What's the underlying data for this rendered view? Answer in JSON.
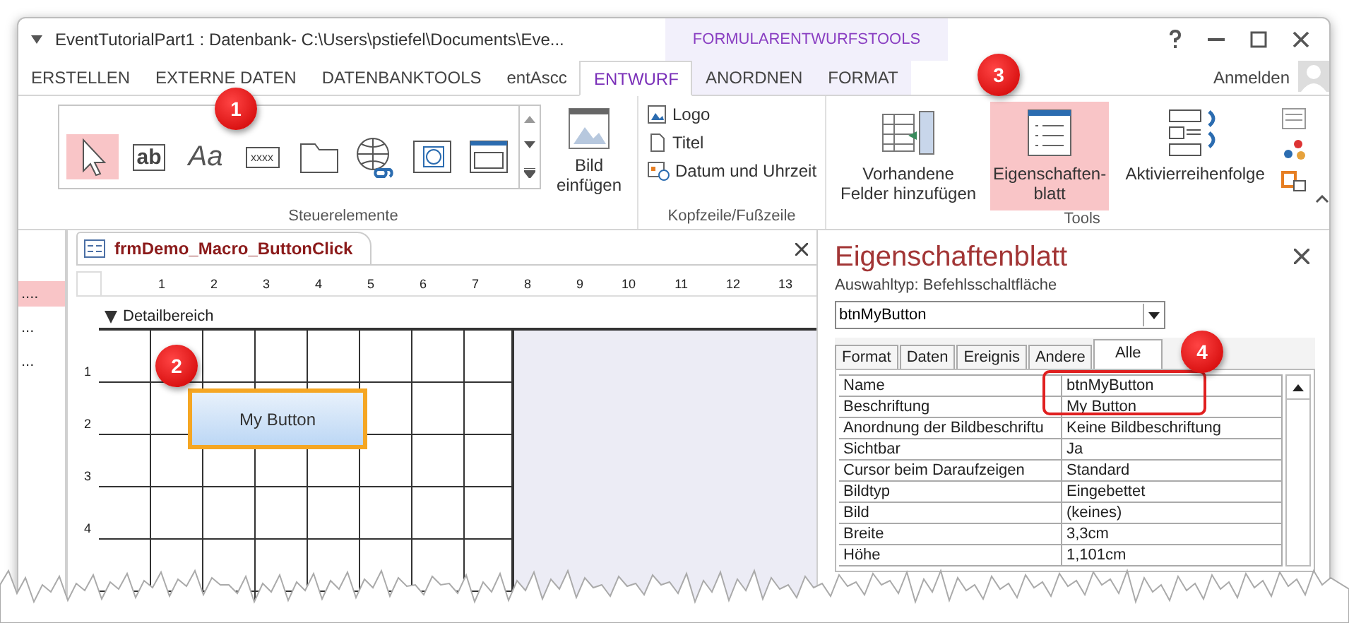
{
  "window": {
    "title": "EventTutorialPart1 : Datenbank- C:\\Users\\pstiefel\\Documents\\Eve...",
    "context_group": "FORMULARENTWURFSTOOLS",
    "user": "Anmelden"
  },
  "ribbon_tabs": [
    {
      "label": "ERSTELLEN",
      "selected": false,
      "contextual": false
    },
    {
      "label": "EXTERNE DATEN",
      "selected": false,
      "contextual": false
    },
    {
      "label": "DATENBANKTOOLS",
      "selected": false,
      "contextual": false
    },
    {
      "label": "entAscc",
      "selected": false,
      "contextual": false
    },
    {
      "label": "ENTWURF",
      "selected": true,
      "contextual": true
    },
    {
      "label": "ANORDNEN",
      "selected": false,
      "contextual": true
    },
    {
      "label": "FORMAT",
      "selected": false,
      "contextual": true
    }
  ],
  "controls_gallery": {
    "group": "Steuerelemente",
    "items": [
      {
        "kind": "pointer",
        "selected": true
      },
      {
        "kind": "textbox",
        "label": "ab",
        "selected": false
      },
      {
        "kind": "label",
        "label": "Aa",
        "selected": false
      },
      {
        "kind": "button",
        "label": "xxxx",
        "selected": false
      },
      {
        "kind": "tab",
        "selected": false
      },
      {
        "kind": "hyperlink",
        "selected": false
      },
      {
        "kind": "web",
        "selected": false
      },
      {
        "kind": "navigation",
        "selected": false
      }
    ]
  },
  "insert_image": {
    "label": "Bild einfügen"
  },
  "header_footer": {
    "group": "Kopfzeile/Fußzeile",
    "items": [
      {
        "kind": "logo",
        "label": "Logo"
      },
      {
        "kind": "title",
        "label": "Titel"
      },
      {
        "kind": "datetime",
        "label": "Datum und Uhrzeit"
      }
    ]
  },
  "tools": {
    "group": "Tools",
    "items": [
      {
        "kind": "fields",
        "label": "Vorhandene Felder hinzufügen",
        "selected": false
      },
      {
        "kind": "sheet",
        "label": "Eigenschaften-blatt",
        "selected": true
      },
      {
        "kind": "order",
        "label": "Aktivierreihenfolge",
        "selected": false
      }
    ]
  },
  "nav_pane": {
    "items": [
      {
        "label": "....",
        "selected": true
      },
      {
        "label": "...",
        "selected": false
      },
      {
        "label": "...",
        "selected": false
      }
    ]
  },
  "document": {
    "tab": "frmDemo_Macro_ButtonClick",
    "ruler": [
      "1",
      "2",
      "3",
      "4",
      "5",
      "6",
      "7",
      "8",
      "9",
      "10",
      "11",
      "12",
      "13"
    ],
    "vertical_ruler": [
      "1",
      "2",
      "3",
      "4"
    ],
    "section": "Detailbereich",
    "button_label": "My Button"
  },
  "property_sheet": {
    "title": "Eigenschaftenblatt",
    "selection_label": "Auswahltyp:",
    "selection_type": "Befehlsschaltfläche",
    "object": "btnMyButton",
    "tabs": [
      {
        "label": "Format",
        "selected": false
      },
      {
        "label": "Daten",
        "selected": false
      },
      {
        "label": "Ereignis",
        "selected": false
      },
      {
        "label": "Andere",
        "selected": false
      },
      {
        "label": "Alle",
        "selected": true
      }
    ],
    "rows": [
      {
        "name": "Name",
        "value": "btnMyButton"
      },
      {
        "name": "Beschriftung",
        "value": "My Button"
      },
      {
        "name": "Anordnung der Bildbeschriftu",
        "value": "Keine Bildbeschriftung"
      },
      {
        "name": "Sichtbar",
        "value": "Ja"
      },
      {
        "name": "Cursor beim Daraufzeigen",
        "value": "Standard"
      },
      {
        "name": "Bildtyp",
        "value": "Eingebettet"
      },
      {
        "name": "Bild",
        "value": "(keines)"
      },
      {
        "name": "Breite",
        "value": "3,3cm"
      },
      {
        "name": "Höhe",
        "value": "1,101cm"
      }
    ]
  },
  "annotations": [
    {
      "kind": "badge",
      "label": "1"
    },
    {
      "kind": "badge",
      "label": "2"
    },
    {
      "kind": "badge",
      "label": "3"
    },
    {
      "kind": "badge",
      "label": "4"
    },
    {
      "kind": "outline"
    }
  ]
}
